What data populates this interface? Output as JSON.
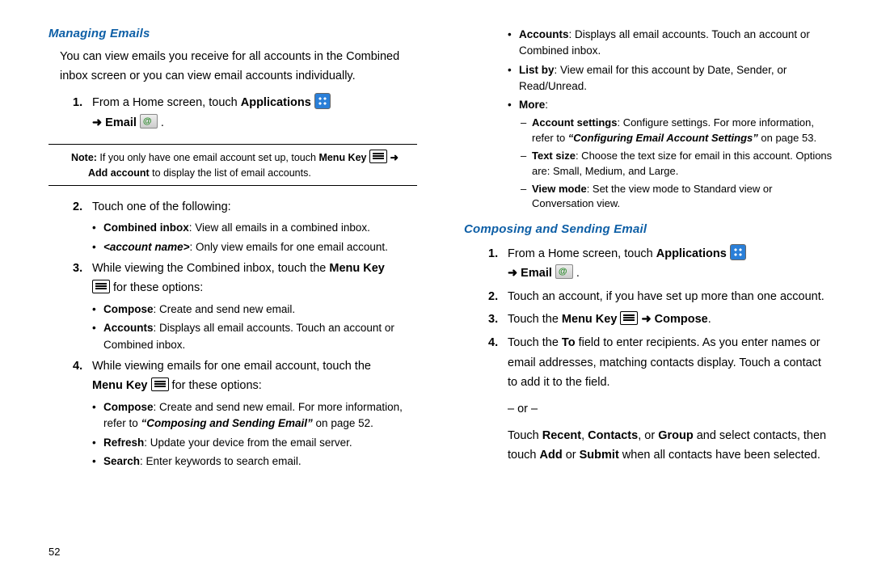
{
  "col1": {
    "h1": "Managing Emails",
    "intro": "You can view emails you receive for all accounts in the Combined inbox screen or you can view email accounts individually.",
    "s1a": "From a Home screen, touch ",
    "s1b": "Applications",
    "s1c": " Email",
    "noteLabel": "Note:",
    "noteA": " If you only have one email account set up, touch ",
    "noteB": "Menu Key",
    "noteC": "Add account",
    "noteD": " to display the list of email accounts.",
    "s2": "Touch one of the following:",
    "b2a_k": "Combined inbox",
    "b2a_v": ": View all emails in a combined inbox.",
    "b2b_k": "<account name>",
    "b2b_v": ": Only view emails for one email account.",
    "s3a": "While viewing the Combined inbox, touch the ",
    "s3b": "Menu Key",
    "s3c": " for these options:",
    "b3a_k": "Compose",
    "b3a_v": ": Create and send new email.",
    "b3b_k": "Accounts",
    "b3b_v": ": Displays all email accounts. Touch an account or Combined inbox.",
    "s4a": "While viewing emails for one email account, touch the ",
    "s4b": "Menu Key",
    "s4c": " for these options:",
    "b4a_k": "Compose",
    "b4a_v1": ": Create and send new email. For more information, refer to ",
    "b4a_ref": "“Composing and Sending Email”",
    "b4a_pg": " on page 52.",
    "b4b_k": "Refresh",
    "b4b_v": ": Update your device from the email server.",
    "b4c_k": "Search",
    "b4c_v": ": Enter keywords to search email."
  },
  "col2": {
    "c2a_k": "Accounts",
    "c2a_v": ": Displays all email accounts. Touch an account or Combined inbox.",
    "c2b_k": "List by",
    "c2b_v": ": View email for this account by Date, Sender, or Read/Unread.",
    "c2c_k": "More",
    "c2c_v": ":",
    "m1_k": "Account settings",
    "m1_v1": ": Configure settings. For more information, refer to ",
    "m1_ref": "“Configuring Email Account Settings”",
    "m1_pg": " on page 53.",
    "m2_k": "Text size",
    "m2_v": ": Choose the text size for email in this account. Options are: Small, Medium, and Large.",
    "m3_k": "View mode",
    "m3_v": ": Set the view mode to Standard view or Conversation view.",
    "h2": "Composing and Sending Email",
    "p1a": "From a Home screen, touch ",
    "p1b": "Applications",
    "p1c": " Email",
    "p2": "Touch an account, if you have set up more than one account.",
    "p3a": "Touch the ",
    "p3b": "Menu Key",
    "p3c": "Compose",
    "p4a": "Touch the ",
    "p4b": "To",
    "p4c": " field to enter recipients. As you enter names or email addresses, matching contacts display. Touch a contact to add it to the field.",
    "or": "– or –",
    "p4d1": "Touch ",
    "p4d2": "Recent",
    "p4d3": ", ",
    "p4d4": "Contacts",
    "p4d5": ", or ",
    "p4d6": "Group",
    "p4d7": " and select contacts, then touch ",
    "p4d8": "Add",
    "p4d9": " or ",
    "p4d10": "Submit",
    "p4d11": " when all contacts have been selected."
  },
  "pageNumber": "52",
  "arrow": "➜"
}
